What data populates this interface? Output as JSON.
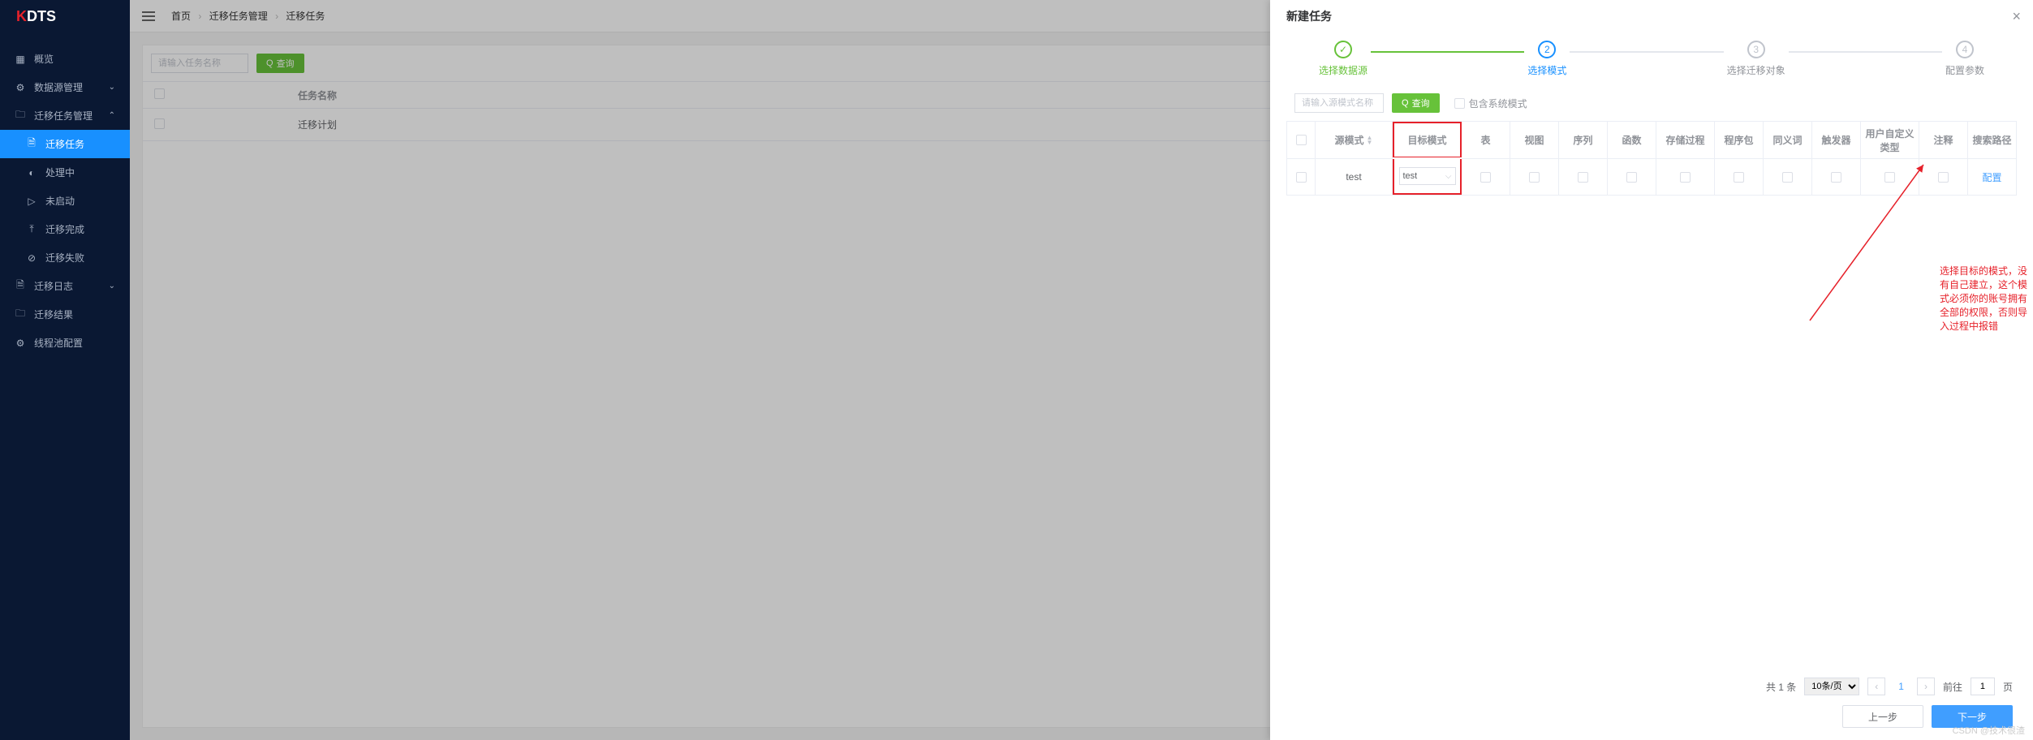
{
  "brand": {
    "k": "K",
    "dts": "DTS"
  },
  "nav": {
    "overview": "概览",
    "datasource": "数据源管理",
    "taskmgmt": "迁移任务管理",
    "tasks": "迁移任务",
    "processing": "处理中",
    "notstarted": "未启动",
    "done": "迁移完成",
    "failed": "迁移失败",
    "log": "迁移日志",
    "result": "迁移结果",
    "threadpool": "线程池配置"
  },
  "crumbs": {
    "home": "首页",
    "mgmt": "迁移任务管理",
    "tasks": "迁移任务"
  },
  "bg": {
    "search_ph": "请输入任务名称",
    "query": "查询",
    "col_name": "任务名称",
    "row1": "迁移计划"
  },
  "modal": {
    "title": "新建任务",
    "steps": {
      "s1": "选择数据源",
      "s2": "选择模式",
      "s3": "选择迁移对象",
      "s4": "配置参数"
    },
    "search_ph": "请输入源模式名称",
    "query": "查询",
    "include_sys": "包含系统模式",
    "cols": {
      "src": "源模式",
      "dst": "目标模式",
      "table": "表",
      "view": "视图",
      "seq": "序列",
      "func": "函数",
      "proc": "存储过程",
      "pkg": "程序包",
      "syn": "同义词",
      "trg": "触发器",
      "udt": "用户自定义类型",
      "comment": "注释",
      "searchpath": "搜索路径"
    },
    "row": {
      "src": "test",
      "dst": "test",
      "action": "配置"
    },
    "pager": {
      "total": "共 1 条",
      "size": "10条/页",
      "goto": "前往",
      "page_suffix": "页",
      "cur": "1",
      "goto_val": "1"
    },
    "prev": "上一步",
    "next": "下一步"
  },
  "annotation": "选择目标的模式，没有自己建立，这个模式必须你的账号拥有全部的权限，否则导入过程中报错",
  "watermark": "CSDN @技术很渣"
}
